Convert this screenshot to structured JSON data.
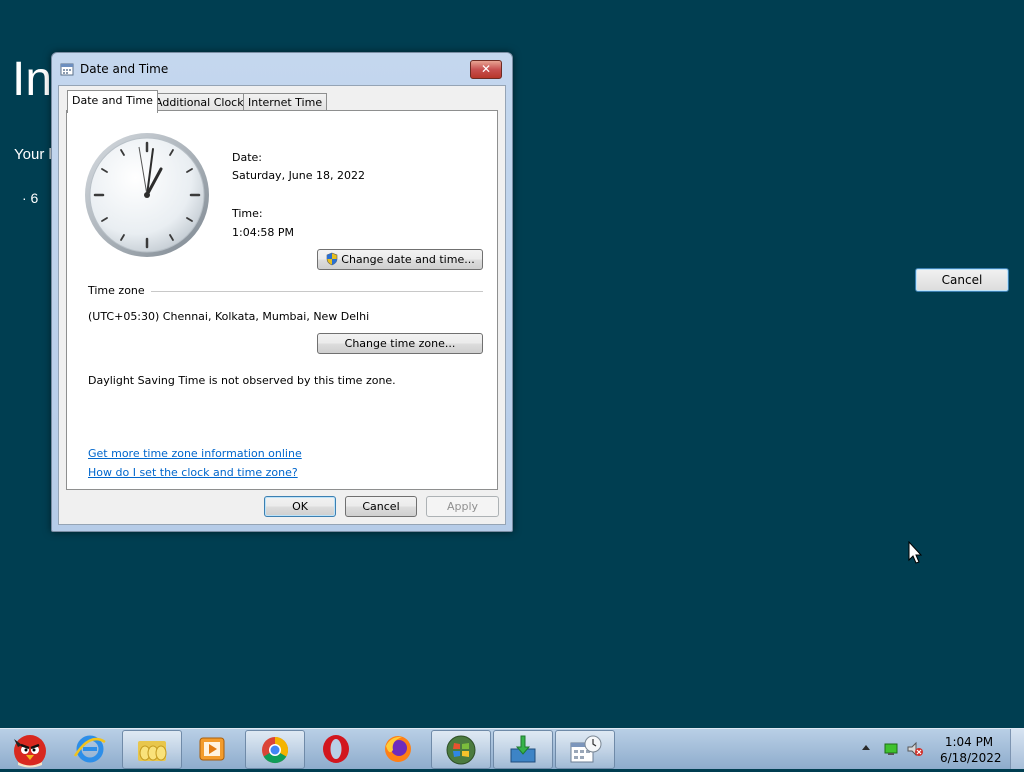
{
  "background": {
    "title": "In",
    "line": "Your l",
    "bullet": "· 6",
    "cancel_label": "Cancel"
  },
  "dialog": {
    "title": "Date and Time",
    "close_label": "✕",
    "tabs": [
      "Date and Time",
      "Additional Clocks",
      "Internet Time"
    ],
    "date_label": "Date:",
    "date_value": "Saturday, June 18, 2022",
    "time_label": "Time:",
    "time_value": "1:04:58 PM",
    "change_datetime_label": "Change date and time...",
    "timezone_heading": "Time zone",
    "timezone_value": "(UTC+05:30) Chennai, Kolkata, Mumbai, New Delhi",
    "change_timezone_label": "Change time zone...",
    "dst_text": "Daylight Saving Time is not observed by this time zone.",
    "link_more_info": "Get more time zone information online",
    "link_howto": "How do I set the clock and time zone?",
    "ok_label": "OK",
    "cancel_label": "Cancel",
    "apply_label": "Apply"
  },
  "taskbar": {
    "items": [
      "angry-birds",
      "internet-explorer",
      "file-explorer",
      "media-player",
      "chrome",
      "opera",
      "firefox",
      "windows-update",
      "installer",
      "date-time"
    ],
    "clock_time": "1:04 PM",
    "clock_date": "6/18/2022"
  },
  "colors": {
    "desktop": "#003e51",
    "link": "#0066cc",
    "taskbar": "#a9c2de"
  }
}
